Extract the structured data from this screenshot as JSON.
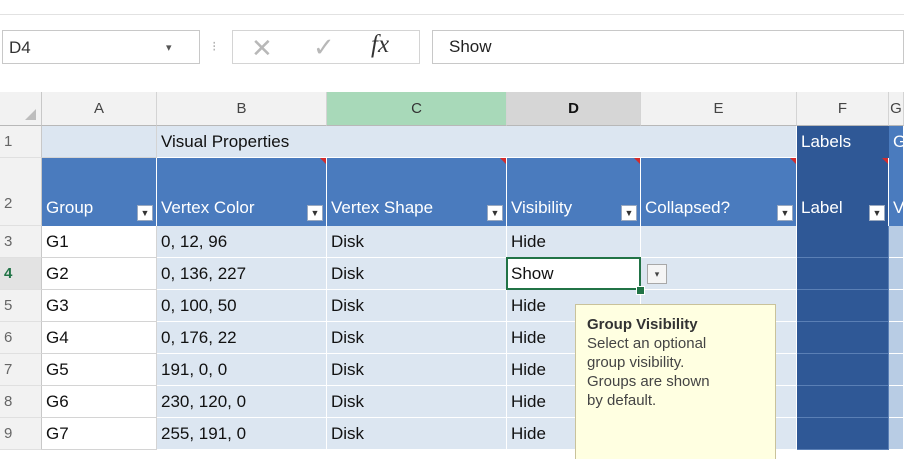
{
  "formula_bar": {
    "name_box": "D4",
    "name_box_arrow": "▾",
    "separator": "⁝",
    "cancel_glyph": "✕",
    "enter_glyph": "✓",
    "fx_label": "fx",
    "formula": "Show"
  },
  "columns": [
    "A",
    "B",
    "C",
    "D",
    "E",
    "F",
    "G"
  ],
  "row_numbers": [
    "1",
    "2",
    "3",
    "4",
    "5",
    "6",
    "7",
    "8",
    "9"
  ],
  "group_header": {
    "visual_properties": "Visual Properties",
    "labels": "Labels",
    "next_fragment": "G"
  },
  "table_headers": [
    "Group",
    "Vertex Color",
    "Vertex Shape",
    "Visibility",
    "Collapsed?",
    "Label",
    "V"
  ],
  "filter_glyph": "▼",
  "rows": [
    {
      "group": "G1",
      "color": "0, 12, 96",
      "shape": "Disk",
      "visibility": "Hide"
    },
    {
      "group": "G2",
      "color": "0, 136, 227",
      "shape": "Disk",
      "visibility": "Show"
    },
    {
      "group": "G3",
      "color": "0, 100, 50",
      "shape": "Disk",
      "visibility": "Hide"
    },
    {
      "group": "G4",
      "color": "0, 176, 22",
      "shape": "Disk",
      "visibility": "Hide"
    },
    {
      "group": "G5",
      "color": "191, 0, 0",
      "shape": "Disk",
      "visibility": "Hide"
    },
    {
      "group": "G6",
      "color": "230, 120, 0",
      "shape": "Disk",
      "visibility": "Hide"
    },
    {
      "group": "G7",
      "color": "255, 191, 0",
      "shape": "Disk",
      "visibility": "Hide"
    }
  ],
  "dropdown_glyph": "▾",
  "tooltip": {
    "title": "Group Visibility",
    "lines": [
      "Select an optional",
      "group visibility.",
      "Groups are shown",
      "by default."
    ]
  }
}
